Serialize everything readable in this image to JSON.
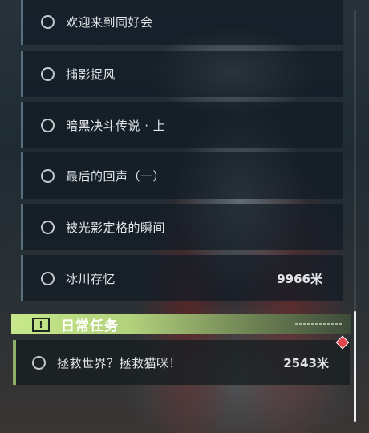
{
  "quests": [
    {
      "title": "欢迎来到同好会",
      "distance": ""
    },
    {
      "title": "捕影捉风",
      "distance": ""
    },
    {
      "title": "暗黑决斗传说 · 上",
      "distance": ""
    },
    {
      "title": "最后的回声（一）",
      "distance": ""
    },
    {
      "title": "被光影定格的瞬间",
      "distance": ""
    },
    {
      "title": "冰川存忆",
      "distance": "9966米"
    }
  ],
  "daily_section": {
    "title": "日常任务",
    "icon": "exclamation-icon",
    "accent": "#c7e88a"
  },
  "daily_quests": [
    {
      "title": "拯救世界？拯救猫咪！",
      "distance": "2543米",
      "marker": "red-diamond-icon"
    }
  ]
}
